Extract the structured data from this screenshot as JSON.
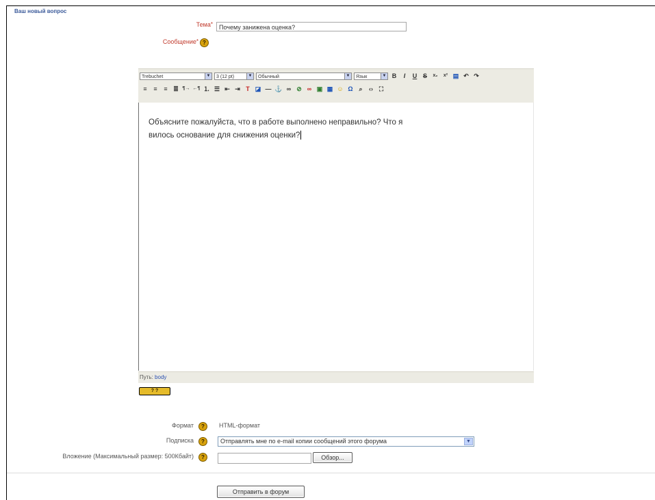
{
  "form": {
    "title": "Ваш новый вопрос",
    "subject": {
      "label": "Тема",
      "required_mark": "*",
      "value": "Почему занижена оценка?"
    },
    "message": {
      "label": "Сообщение",
      "required_mark": "*"
    },
    "help_icon_glyph": "?"
  },
  "editor": {
    "font_family": "Trebuchet",
    "font_size": "3 (12 pt)",
    "paragraph_style": "Обычный",
    "language": "Язык",
    "row1_icons": [
      "bold-icon",
      "italic-icon",
      "underline-icon",
      "strikethrough-icon",
      "subscript-icon",
      "superscript-icon",
      "clean-word-icon",
      "undo-icon",
      "redo-icon"
    ],
    "row2_icons": [
      "align-left-icon",
      "align-center-icon",
      "align-right-icon",
      "justify-icon",
      "ltr-icon",
      "rtl-icon",
      "ordered-list-icon",
      "unordered-list-icon",
      "outdent-icon",
      "indent-icon",
      "text-color-icon",
      "background-color-icon",
      "horizontal-rule-icon",
      "anchor-icon",
      "link-icon",
      "unlink-icon",
      "nolink-icon",
      "image-icon",
      "table-icon",
      "smiley-icon",
      "special-char-icon",
      "search-replace-icon",
      "html-source-icon",
      "fullscreen-icon"
    ],
    "content_line1": "Объясните пожалуйста, что в работе выполнено неправильно? Что я",
    "content_line2": "вилось основание для снижения оценки?",
    "path_label": "Путь:",
    "path_value": "body",
    "help_button": "? ?"
  },
  "format": {
    "label": "Формат",
    "value": "HTML-формат"
  },
  "subscription": {
    "label": "Подписка",
    "selected": "Отправлять мне по e-mail копии сообщений этого форума"
  },
  "attachment": {
    "label": "Вложение (Максимальный размер: 500Кбайт)",
    "value": "",
    "browse_label": "Обзор..."
  },
  "submit_label": "Отправить в форум",
  "colors": {
    "accent": "#3b5a9a",
    "required": "#c0392b",
    "toolbar_bg": "#ecebe3",
    "help_icon": "#d8a20c"
  }
}
